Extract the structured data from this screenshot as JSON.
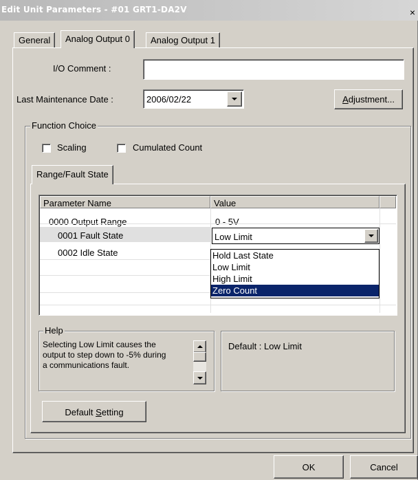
{
  "window": {
    "title": "Edit Unit Parameters - #01 GRT1-DA2V",
    "close_glyph": "×"
  },
  "tabs": [
    "General",
    "Analog Output 0",
    "Analog Output 1"
  ],
  "io_comment": {
    "label": "I/O Comment :",
    "value": ""
  },
  "last_maintenance": {
    "label": "Last Maintenance Date :",
    "value": "2006/02/22"
  },
  "adjustment_button": {
    "prefix": "",
    "mnemonic": "A",
    "rest": "djustment..."
  },
  "function_choice": {
    "label": "Function Choice",
    "scaling": {
      "label": "Scaling",
      "checked": false
    },
    "cumulated": {
      "label": "Cumulated Count",
      "checked": false
    }
  },
  "inner_tab": "Range/Fault State",
  "grid": {
    "columns": [
      "Parameter Name",
      "Value"
    ],
    "rows": [
      {
        "name": "0000 Output Range",
        "value": "0 - 5V"
      },
      {
        "name": "0001 Fault State",
        "value": "Low Limit"
      },
      {
        "name": "0002 Idle State",
        "value": ""
      }
    ]
  },
  "dropdown_options": [
    "Hold Last State",
    "Low Limit",
    "High Limit",
    "Zero Count"
  ],
  "dropdown_selected": "Zero Count",
  "help": {
    "label": "Help",
    "text_lines": [
      "Selecting Low Limit causes the",
      "output to step down to -5% during",
      "a communications fault."
    ],
    "default_text": "Default : Low Limit"
  },
  "default_setting_button": {
    "prefix": "Default ",
    "mnemonic": "S",
    "rest": "etting"
  },
  "ok_button": "OK",
  "cancel_button": "Cancel",
  "colors": {
    "selection": "#0a246a",
    "face": "#d4d0c8"
  }
}
